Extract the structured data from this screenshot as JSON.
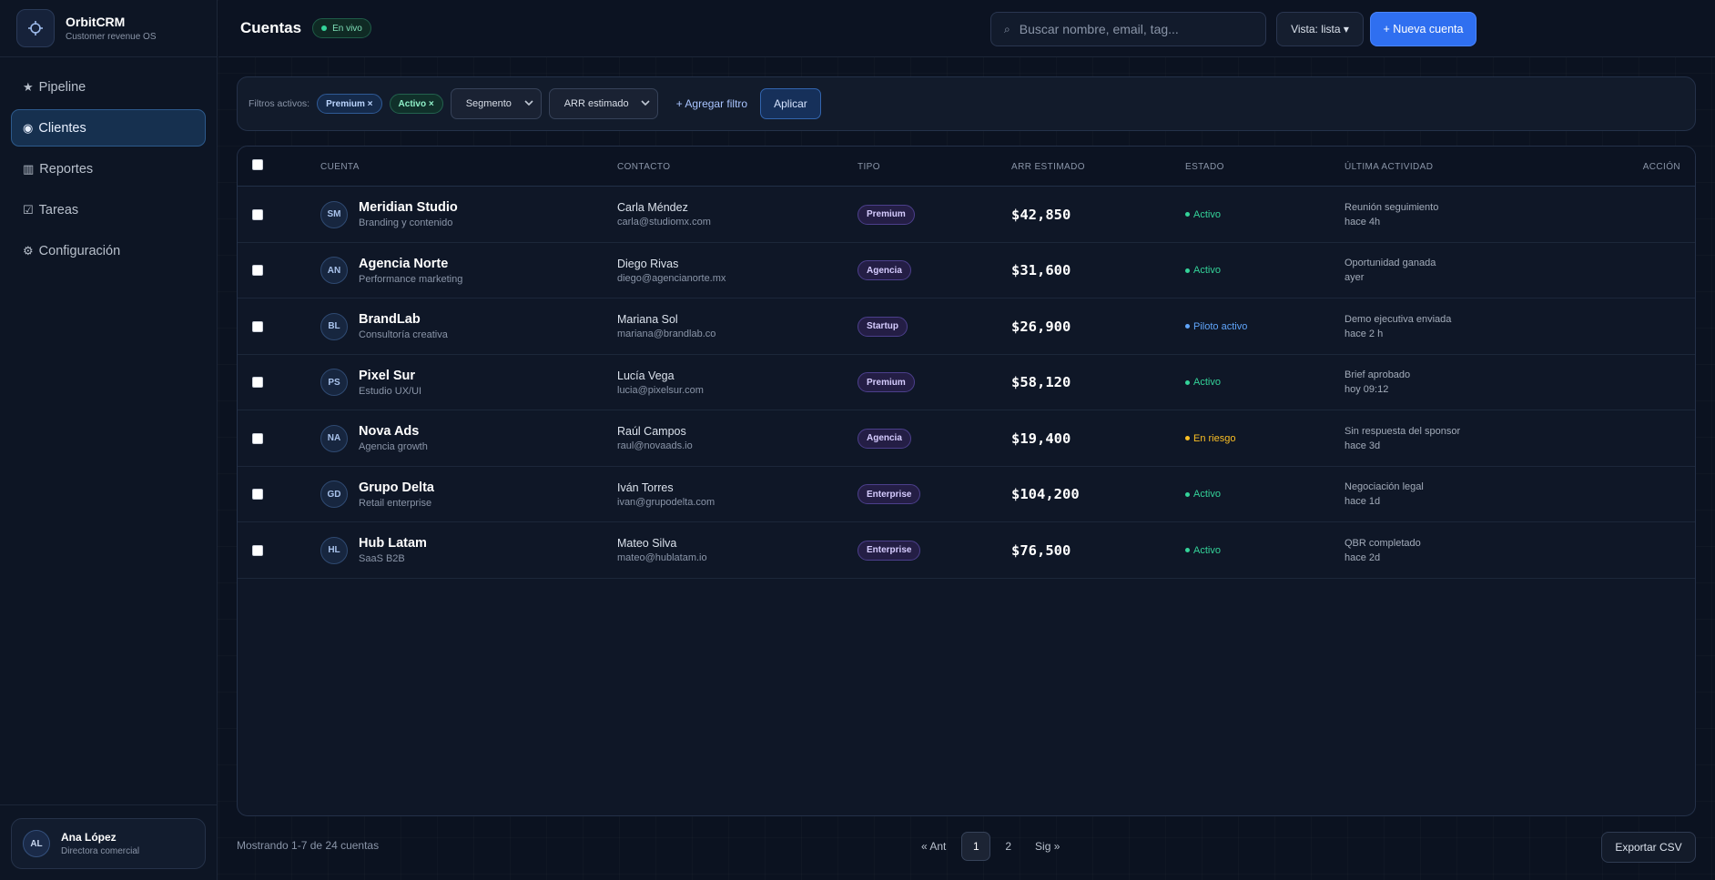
{
  "app": {
    "name": "OrbitCRM",
    "tagline": "Customer revenue OS"
  },
  "nav": [
    {
      "icon": "★",
      "label": "Pipeline",
      "active": false
    },
    {
      "icon": "◉",
      "label": "Clientes",
      "active": true
    },
    {
      "icon": "▥",
      "label": "Reportes",
      "active": false
    },
    {
      "icon": "☑",
      "label": "Tareas",
      "active": false
    },
    {
      "icon": "⚙",
      "label": "Configuración",
      "active": false
    }
  ],
  "user": {
    "initials": "AL",
    "name": "Ana López",
    "role": "Directora comercial"
  },
  "header": {
    "title": "Cuentas",
    "live_label": "En vivo"
  },
  "search": {
    "placeholder": "Buscar nombre, email, tag...",
    "icon": "⌕"
  },
  "view_button": "Vista: lista ▾",
  "new_button": "+ Nueva cuenta",
  "filters": {
    "label": "Filtros activos:",
    "chips": [
      {
        "label": "Premium ×",
        "color": "blue"
      },
      {
        "label": "Activo ×",
        "color": "green"
      }
    ],
    "segment_select": "Segmento",
    "arr_select": "ARR estimado",
    "add_filter": "+ Agregar filtro",
    "apply": "Aplicar"
  },
  "table": {
    "columns": [
      "CUENTA",
      "CONTACTO",
      "TIPO",
      "ARR ESTIMADO",
      "ESTADO",
      "ÚLTIMA ACTIVIDAD",
      "ACCIÓN"
    ],
    "rows": [
      {
        "initials": "SM",
        "name": "Meridian Studio",
        "sub": "Branding y contenido",
        "contact": "Carla Méndez",
        "email": "carla@studiomx.com",
        "type": "Premium",
        "arr": "$42,850",
        "status": "Activo",
        "status_color": "#34d399",
        "activity": "Reunión seguimiento",
        "time": "hace 4h"
      },
      {
        "initials": "AN",
        "name": "Agencia Norte",
        "sub": "Performance marketing",
        "contact": "Diego Rivas",
        "email": "diego@agencianorte.mx",
        "type": "Agencia",
        "arr": "$31,600",
        "status": "Activo",
        "status_color": "#34d399",
        "activity": "Oportunidad ganada",
        "time": "ayer"
      },
      {
        "initials": "BL",
        "name": "BrandLab",
        "sub": "Consultoría creativa",
        "contact": "Mariana Sol",
        "email": "mariana@brandlab.co",
        "type": "Startup",
        "arr": "$26,900",
        "status": "Piloto activo",
        "status_color": "#60a5fa",
        "activity": "Demo ejecutiva enviada",
        "time": "hace 2 h"
      },
      {
        "initials": "PS",
        "name": "Pixel Sur",
        "sub": "Estudio UX/UI",
        "contact": "Lucía Vega",
        "email": "lucia@pixelsur.com",
        "type": "Premium",
        "arr": "$58,120",
        "status": "Activo",
        "status_color": "#34d399",
        "activity": "Brief aprobado",
        "time": "hoy 09:12"
      },
      {
        "initials": "NA",
        "name": "Nova Ads",
        "sub": "Agencia growth",
        "contact": "Raúl Campos",
        "email": "raul@novaads.io",
        "type": "Agencia",
        "arr": "$19,400",
        "status": "En riesgo",
        "status_color": "#fbbf24",
        "activity": "Sin respuesta del sponsor",
        "time": "hace 3d"
      },
      {
        "initials": "GD",
        "name": "Grupo Delta",
        "sub": "Retail enterprise",
        "contact": "Iván Torres",
        "email": "ivan@grupodelta.com",
        "type": "Enterprise",
        "arr": "$104,200",
        "status": "Activo",
        "status_color": "#34d399",
        "activity": "Negociación legal",
        "time": "hace 1d"
      },
      {
        "initials": "HL",
        "name": "Hub Latam",
        "sub": "SaaS B2B",
        "contact": "Mateo Silva",
        "email": "mateo@hublatam.io",
        "type": "Enterprise",
        "arr": "$76,500",
        "status": "Activo",
        "status_color": "#34d399",
        "activity": "QBR completado",
        "time": "hace 2d"
      }
    ]
  },
  "footer": {
    "showing": "Mostrando 1-7 de 24 cuentas",
    "prev": "« Ant",
    "current_page": "1",
    "next_page": "2",
    "next": "Sig »",
    "export": "Exportar CSV"
  }
}
